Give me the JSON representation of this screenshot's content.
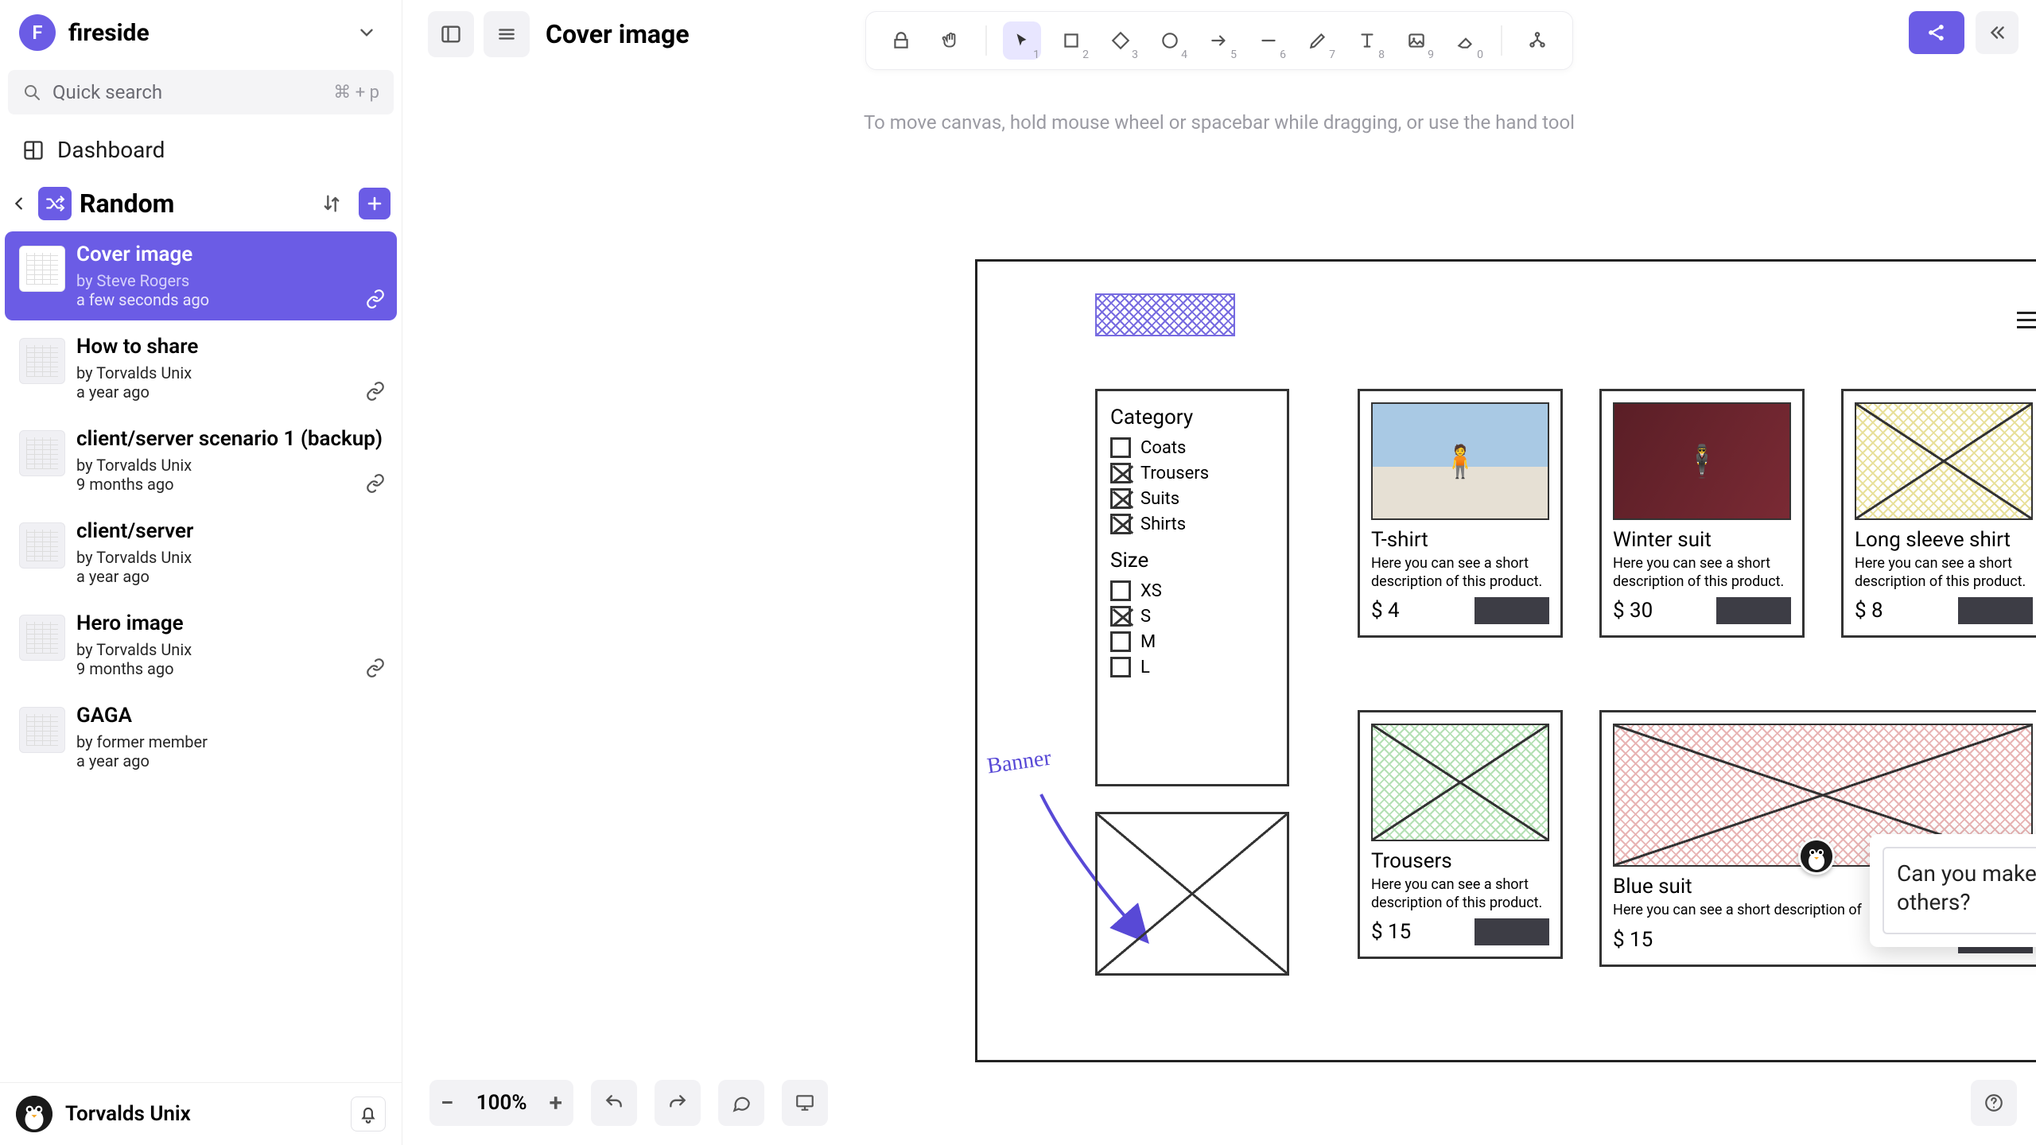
{
  "workspace": {
    "initial": "F",
    "name": "fireside"
  },
  "search": {
    "placeholder": "Quick search",
    "shortcut": "⌘ + p"
  },
  "nav": {
    "dashboard": "Dashboard"
  },
  "section": {
    "title": "Random"
  },
  "docs": [
    {
      "title": "Cover image",
      "by": "by Steve Rogers",
      "time": "a few seconds ago",
      "selected": true,
      "link": true
    },
    {
      "title": "How to share",
      "by": "by Torvalds Unix",
      "time": "a year ago",
      "selected": false,
      "link": true
    },
    {
      "title": "client/server scenario 1 (backup)",
      "by": "by Torvalds Unix",
      "time": "9 months ago",
      "selected": false,
      "link": true
    },
    {
      "title": "client/server",
      "by": "by Torvalds Unix",
      "time": "a year ago",
      "selected": false,
      "link": false
    },
    {
      "title": "Hero image",
      "by": "by Torvalds Unix",
      "time": "9 months ago",
      "selected": false,
      "link": true
    },
    {
      "title": "GAGA",
      "by": "by former member",
      "time": "a year ago",
      "selected": false,
      "link": false
    }
  ],
  "current_user": "Torvalds Unix",
  "board": {
    "title": "Cover image"
  },
  "tools": [
    {
      "name": "lock",
      "key": ""
    },
    {
      "name": "hand",
      "key": ""
    },
    {
      "name": "select",
      "key": "1",
      "active": true
    },
    {
      "name": "rect",
      "key": "2"
    },
    {
      "name": "diamond",
      "key": "3"
    },
    {
      "name": "circle",
      "key": "4"
    },
    {
      "name": "arrow",
      "key": "5"
    },
    {
      "name": "line",
      "key": "6"
    },
    {
      "name": "pencil",
      "key": "7"
    },
    {
      "name": "text",
      "key": "8"
    },
    {
      "name": "image",
      "key": "9"
    },
    {
      "name": "eraser",
      "key": "0"
    },
    {
      "name": "share-diagram",
      "key": ""
    }
  ],
  "canvas_hint": "To move canvas, hold mouse wheel or spacebar while dragging, or use the hand tool",
  "mockup": {
    "menu_label": "menu",
    "filters": {
      "category_header": "Category",
      "categories": [
        {
          "label": "Coats",
          "checked": false
        },
        {
          "label": "Trousers",
          "checked": true
        },
        {
          "label": "Suits",
          "checked": true
        },
        {
          "label": "Shirts",
          "checked": true
        }
      ],
      "size_header": "Size",
      "sizes": [
        {
          "label": "XS",
          "checked": false
        },
        {
          "label": "S",
          "checked": true
        },
        {
          "label": "M",
          "checked": false
        },
        {
          "label": "L",
          "checked": false
        }
      ]
    },
    "banner_label": "Banner",
    "products": [
      {
        "title": "T-shirt",
        "desc": "Here you can see a short description of this product.",
        "price": "$ 4"
      },
      {
        "title": "Winter suit",
        "desc": "Here you can see a short description of this product.",
        "price": "$ 30"
      },
      {
        "title": "Long sleeve shirt",
        "desc": "Here you can see a short description of this product.",
        "price": "$ 8"
      },
      {
        "title": "Trousers",
        "desc": "Here you can see a short description of this product.",
        "price": "$ 15"
      },
      {
        "title": "Blue suit",
        "desc": "Here you can see a short description of",
        "price": "$ 15"
      }
    ]
  },
  "comment": {
    "text": "Can you make it as wide as the others?"
  },
  "zoom": "100%"
}
